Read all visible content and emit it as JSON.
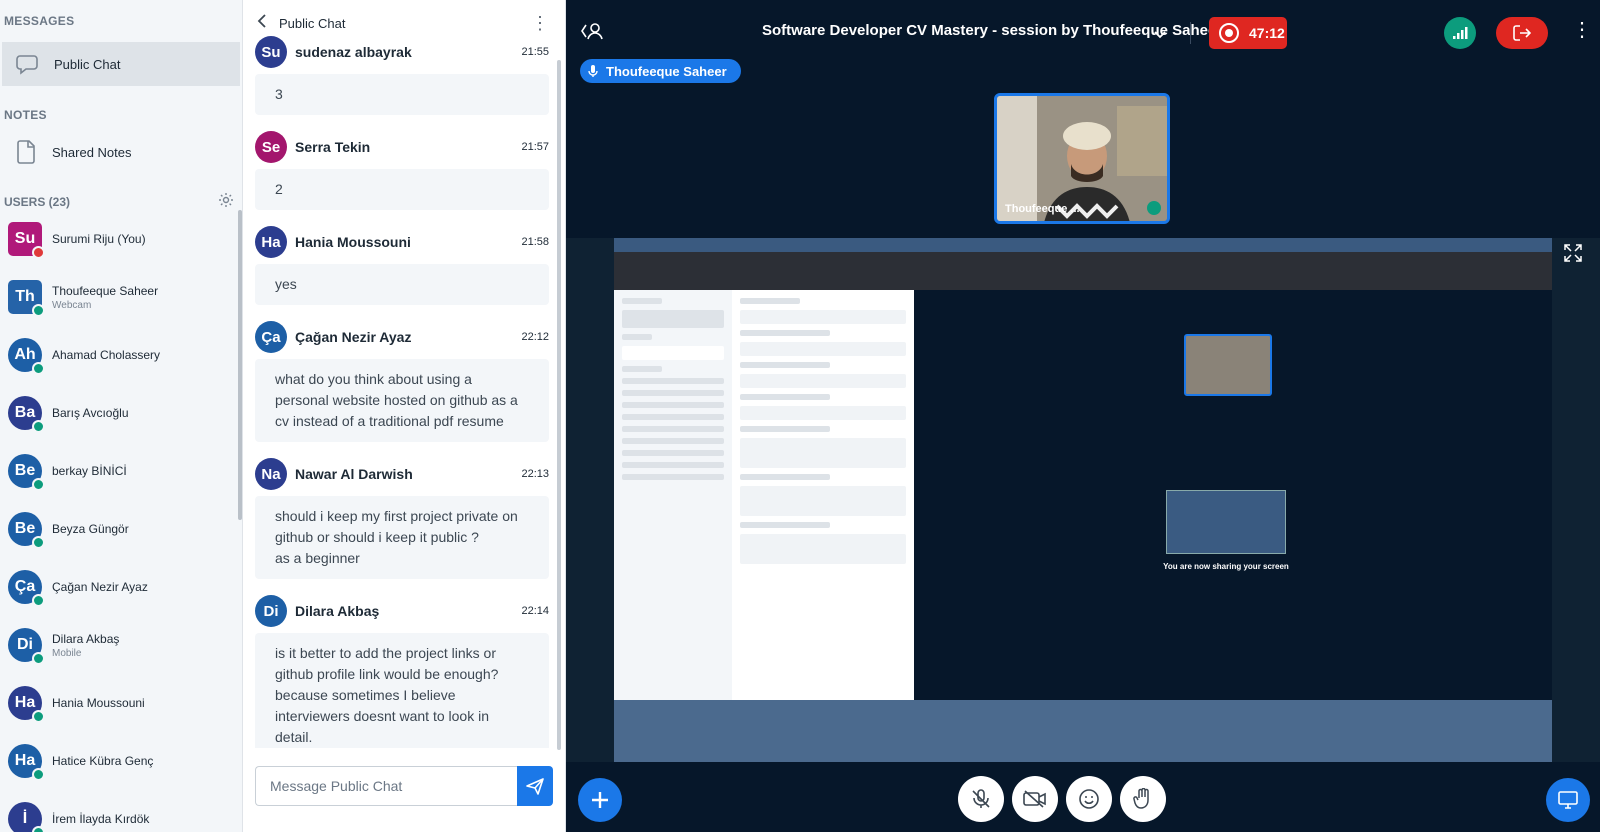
{
  "sidebar": {
    "messages_title": "MESSAGES",
    "public_chat_label": "Public Chat",
    "notes_title": "NOTES",
    "shared_notes_label": "Shared Notes",
    "users_title": "USERS (23)",
    "users": [
      {
        "initials": "Su",
        "name": "Surumi Riju (You)",
        "sub": "",
        "color": "#b0197a",
        "shape": "square",
        "badge": "red"
      },
      {
        "initials": "Th",
        "name": "Thoufeeque Saheer",
        "sub": "Webcam",
        "color": "#2563a8",
        "shape": "square",
        "badge": "green"
      },
      {
        "initials": "Ah",
        "name": "Ahamad Cholassery",
        "sub": "",
        "color": "#1d5fa6",
        "shape": "round",
        "badge": "green"
      },
      {
        "initials": "Ba",
        "name": "Barış Avcıoğlu",
        "sub": "",
        "color": "#2c3d8f",
        "shape": "round",
        "badge": "green"
      },
      {
        "initials": "Be",
        "name": "berkay BİNİCİ",
        "sub": "",
        "color": "#1d5fa6",
        "shape": "round",
        "badge": "green"
      },
      {
        "initials": "Be",
        "name": "Beyza Güngör",
        "sub": "",
        "color": "#1d5fa6",
        "shape": "round",
        "badge": "green"
      },
      {
        "initials": "Ça",
        "name": "Çağan Nezir Ayaz",
        "sub": "",
        "color": "#1d5fa6",
        "shape": "round",
        "badge": "green"
      },
      {
        "initials": "Di",
        "name": "Dilara Akbaş",
        "sub": "Mobile",
        "color": "#1d5fa6",
        "shape": "round",
        "badge": "green"
      },
      {
        "initials": "Ha",
        "name": "Hania Moussouni",
        "sub": "",
        "color": "#2c3d8f",
        "shape": "round",
        "badge": "green"
      },
      {
        "initials": "Ha",
        "name": "Hatice Kübra Genç",
        "sub": "",
        "color": "#1d5fa6",
        "shape": "round",
        "badge": "green"
      },
      {
        "initials": "İ",
        "name": "İrem İlayda Kırdök",
        "sub": "",
        "color": "#2c3d8f",
        "shape": "round",
        "badge": "green"
      }
    ]
  },
  "chat": {
    "title": "Public Chat",
    "messages": [
      {
        "initials": "Su",
        "name": "sudenaz albayrak",
        "time": "21:55",
        "text": "3",
        "color": "#2c3d8f"
      },
      {
        "initials": "Se",
        "name": "Serra Tekin",
        "time": "21:57",
        "text": "2",
        "color": "#a3166d"
      },
      {
        "initials": "Ha",
        "name": "Hania Moussouni",
        "time": "21:58",
        "text": "yes",
        "color": "#2c3d8f"
      },
      {
        "initials": "Ça",
        "name": "Çağan Nezir Ayaz",
        "time": "22:12",
        "text": "what do you think about using a personal website hosted on github as a cv instead of a traditional pdf resume",
        "color": "#1d5fa6"
      },
      {
        "initials": "Na",
        "name": "Nawar Al Darwish",
        "time": "22:13",
        "text": "should i keep my first project private on github or should i keep it public ?\nas a beginner",
        "color": "#2c3d8f"
      },
      {
        "initials": "Di",
        "name": "Dilara Akbaş",
        "time": "22:14",
        "text": "is it better to add the project links or github profile link would be enough? because sometimes I believe interviewers doesnt want to look in detail.",
        "color": "#1d5fa6"
      }
    ],
    "input_placeholder": "Message Public Chat"
  },
  "main": {
    "meeting_title": "Software Developer CV Mastery - session by Thoufeeque Saheer",
    "recording_time": "47:12",
    "talker_name": "Thoufeeque Saheer",
    "webcam_name": "Thoufeeque ...",
    "share_status": "You are now sharing your screen"
  },
  "colors": {
    "primary": "#1b78e8",
    "danger": "#df2721",
    "success": "#0c9c7d",
    "stage_bg": "#06172a"
  },
  "icons": {
    "chat": "chat-bubble-icon",
    "notes": "document-icon",
    "settings": "gear-icon",
    "record": "record-icon",
    "leave": "leave-icon",
    "mic": "microphone-icon"
  }
}
